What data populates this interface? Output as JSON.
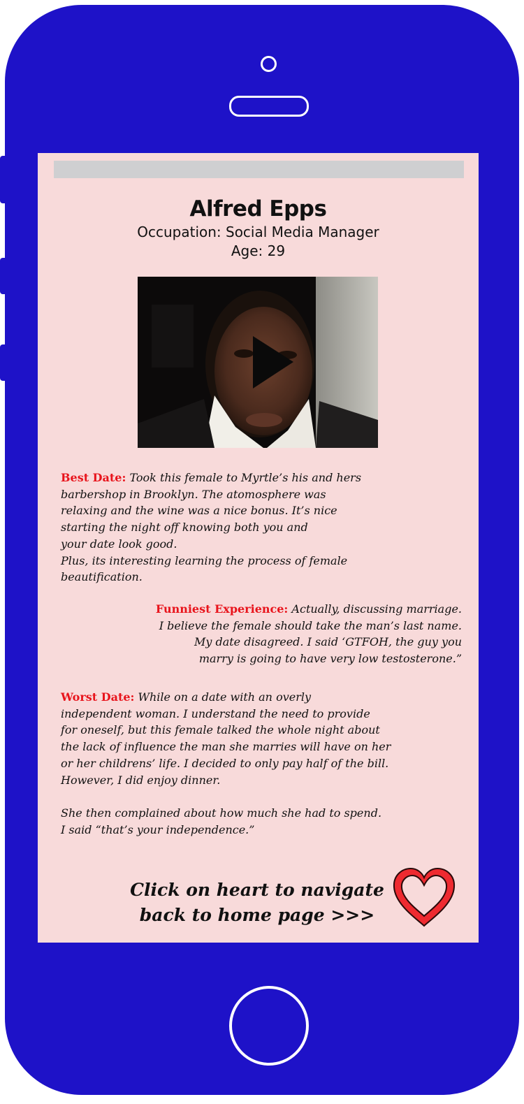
{
  "profile": {
    "name": "Alfred Epps",
    "occupation": "Occupation: Social Media Manager",
    "age": "Age: 29"
  },
  "video": {
    "play_icon": "play-icon"
  },
  "best_date": {
    "label": "Best Date:",
    "text": "Took this female to Myrtle’s his and hers\nbarbershop in Brooklyn. The atomosphere was\nrelaxing and the wine was a nice bonus. It’s nice\nstarting the night off knowing both you and\nyour date look good.\nPlus, its interesting learning the process of female\nbeautification."
  },
  "funniest_experience": {
    "label": "Funniest Experience:",
    "text": "Actually, discussing marriage.\nI believe the female should take the man’s last name.\nMy date disagreed. I said ‘GTFOH, the guy you\nmarry is going to have very low testosterone.”"
  },
  "worst_date": {
    "label": "Worst Date:",
    "text": "While on a date with an overly\nindependent woman. I understand the need to provide\nfor oneself, but this female talked the whole night about\nthe lack of influence the man she marries will have on her\nor her childrens’ life. I decided to only pay half of the bill.\nHowever, I did enjoy dinner.",
    "text_2": "She then complained about how much she had to spend.\nI said “that’s your independence.”"
  },
  "navigation": {
    "text": "Click on heart to navigate\nback to home page >>>",
    "heart_icon": "heart-icon"
  },
  "colors": {
    "phone_body": "#1e12c8",
    "screen_bg": "#f8dada",
    "label_red": "#e8141c",
    "heart_red": "#ee2a30"
  }
}
